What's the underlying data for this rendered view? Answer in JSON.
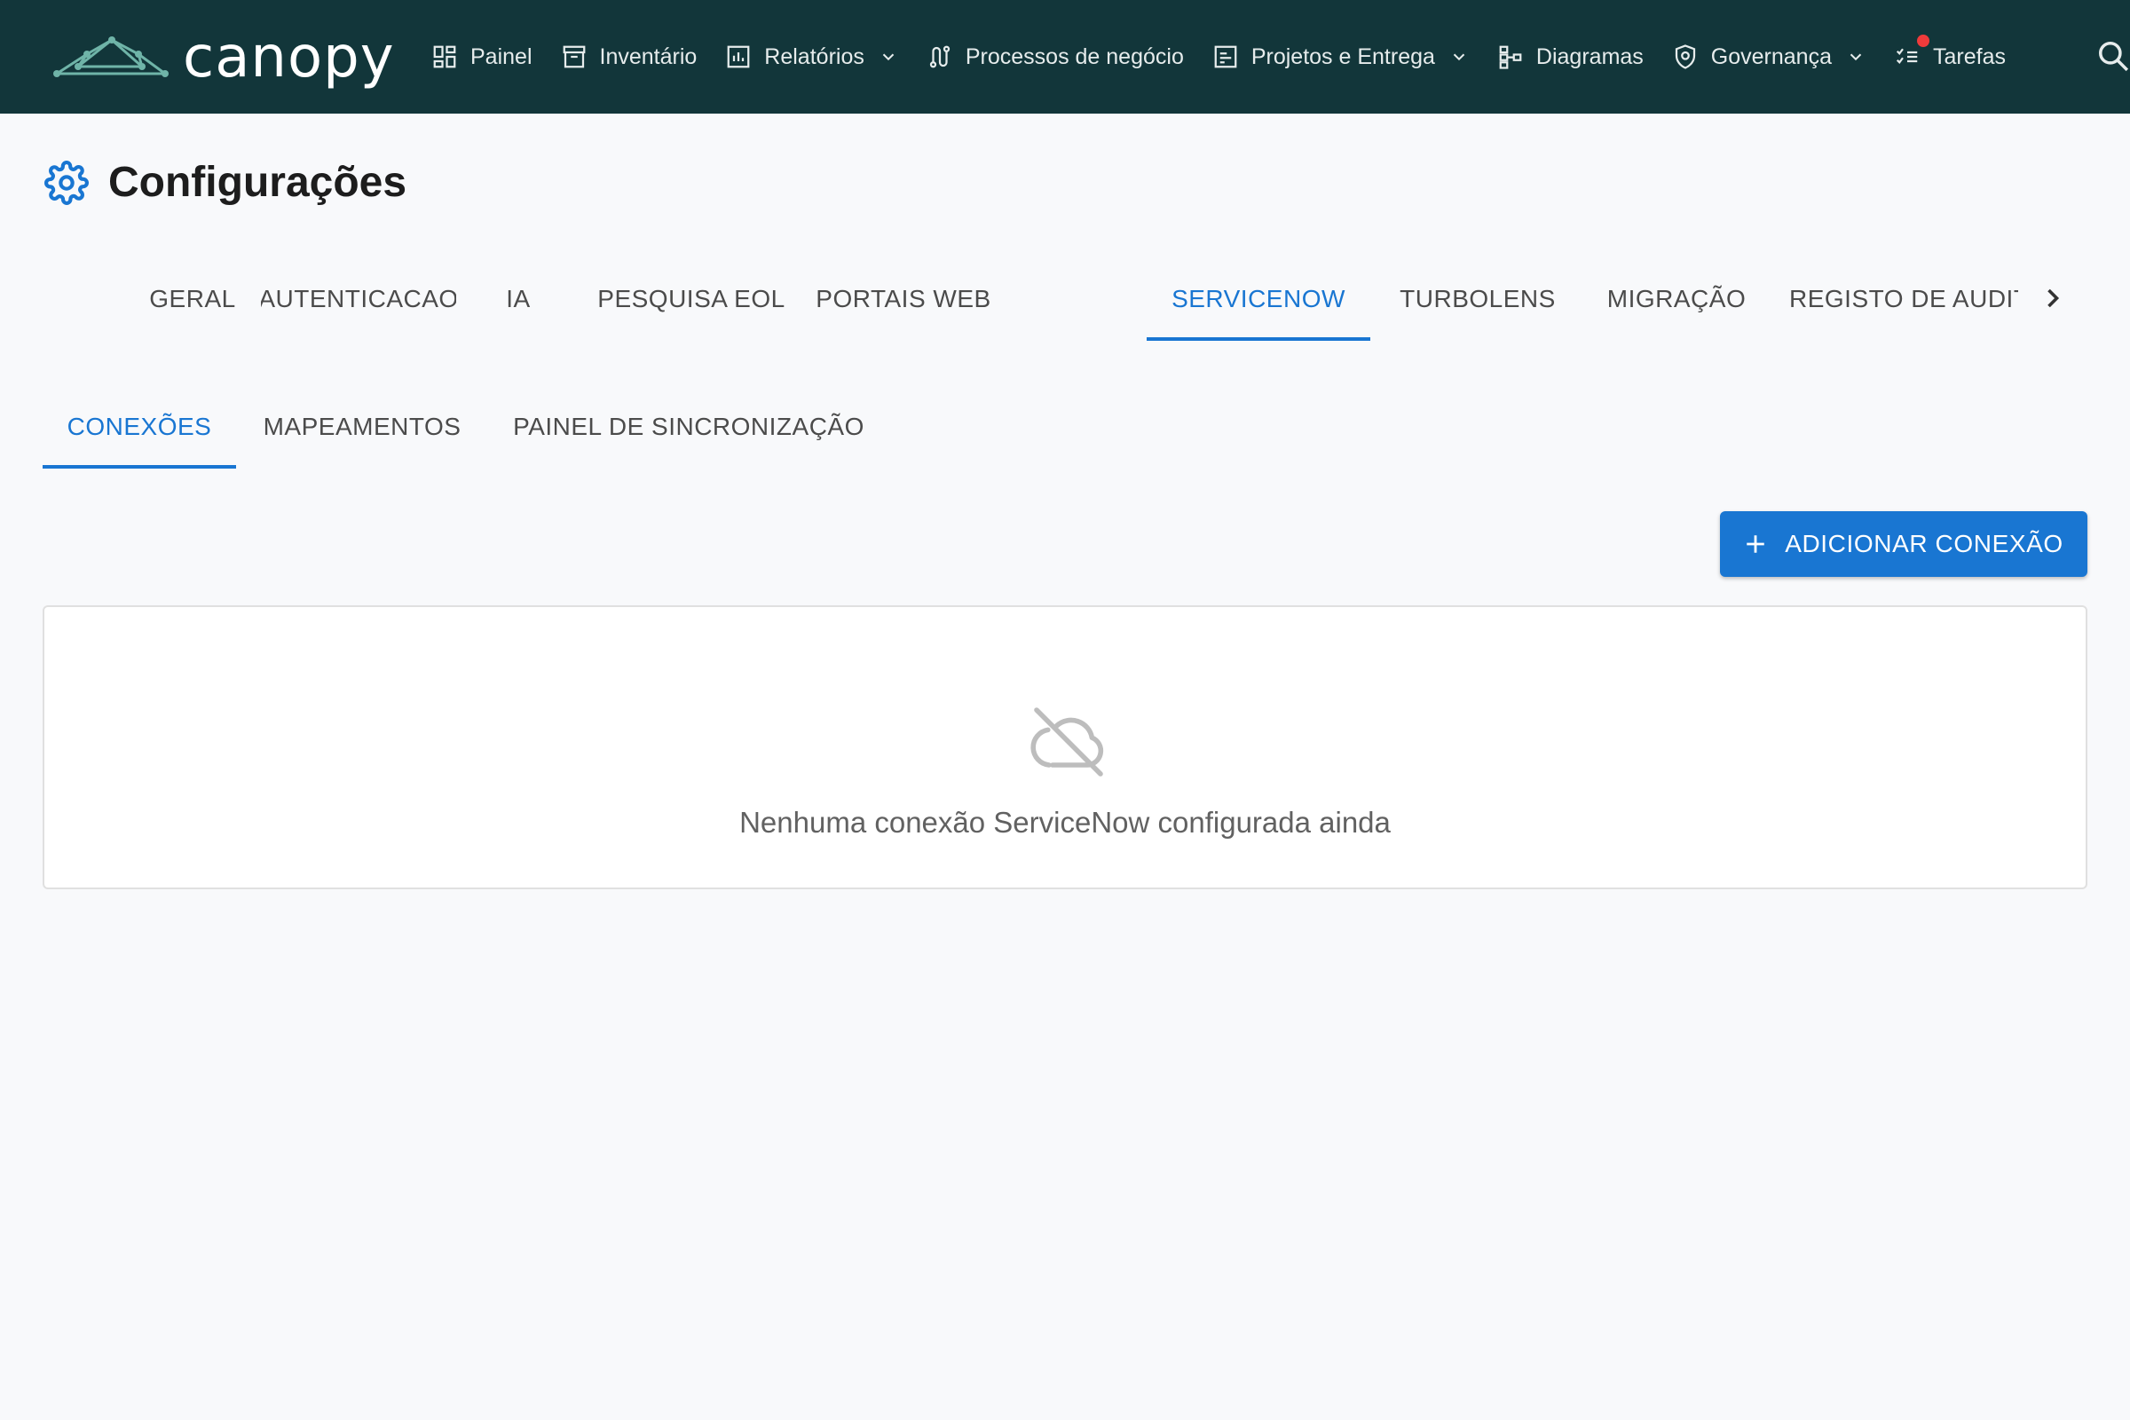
{
  "app": {
    "name": "canopy"
  },
  "nav": {
    "items": [
      {
        "label": "Painel",
        "icon": "dashboard-icon"
      },
      {
        "label": "Inventário",
        "icon": "archive-icon"
      },
      {
        "label": "Relatórios",
        "icon": "bar-chart-icon",
        "dropdown": true
      },
      {
        "label": "Processos de negócio",
        "icon": "route-icon"
      },
      {
        "label": "Projetos e Entrega",
        "icon": "project-icon",
        "dropdown": true
      },
      {
        "label": "Diagramas",
        "icon": "diagram-icon"
      },
      {
        "label": "Governança",
        "icon": "shield-icon",
        "dropdown": true
      },
      {
        "label": "Tarefas",
        "icon": "checklist-icon",
        "notification": true
      }
    ],
    "search_icon": "search-icon"
  },
  "page": {
    "title": "Configurações",
    "icon": "gear-icon"
  },
  "tabs": [
    {
      "label": "GERAL"
    },
    {
      "label": "AUTENTICACAO"
    },
    {
      "label": "IA"
    },
    {
      "label": "PESQUISA EOL"
    },
    {
      "label": "PORTAIS WEB"
    },
    {
      "label": "SERVICENOW",
      "active": true
    },
    {
      "label": "TURBOLENS"
    },
    {
      "label": "MIGRAÇÃO"
    },
    {
      "label": "REGISTO DE AUDITORIA"
    }
  ],
  "subtabs": [
    {
      "label": "CONEXÕES",
      "active": true
    },
    {
      "label": "MAPEAMENTOS"
    },
    {
      "label": "PAINEL DE SINCRONIZAÇÃO"
    }
  ],
  "actions": {
    "add_connection": "ADICIONAR CONEXÃO"
  },
  "empty_state": {
    "message": "Nenhuma conexão ServiceNow configurada ainda",
    "icon": "cloud-off-icon"
  },
  "colors": {
    "topbar": "#12363a",
    "accent": "#1976d2",
    "notification": "#ef3b3b"
  }
}
